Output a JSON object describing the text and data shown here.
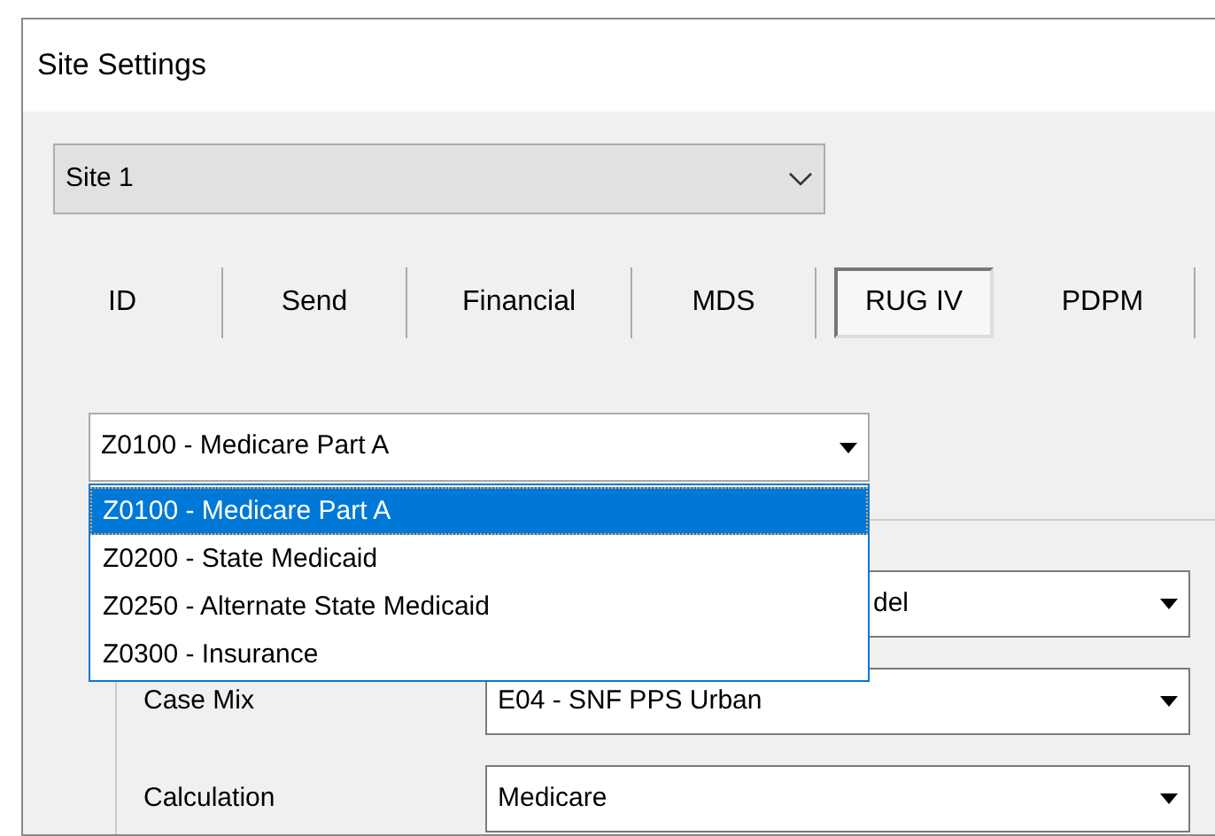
{
  "window": {
    "title": "Site Settings"
  },
  "site": {
    "value": "Site 1"
  },
  "tabs": [
    {
      "label": "ID",
      "selected": false
    },
    {
      "label": "Send",
      "selected": false
    },
    {
      "label": "Financial",
      "selected": false
    },
    {
      "label": "MDS",
      "selected": false
    },
    {
      "label": "RUG IV",
      "selected": true
    },
    {
      "label": "PDPM",
      "selected": false
    }
  ],
  "payer": {
    "value": "Z0100 - Medicare Part A",
    "expanded": true,
    "options": [
      {
        "label": "Z0100 - Medicare Part A",
        "selected": true
      },
      {
        "label": "Z0200 - State Medicaid",
        "selected": false
      },
      {
        "label": "Z0250 - Alternate State Medicaid",
        "selected": false
      },
      {
        "label": "Z0300 - Insurance",
        "selected": false
      }
    ]
  },
  "fields": [
    {
      "value": "del"
    },
    {
      "label": "Case Mix",
      "value": "E04 - SNF PPS Urban"
    },
    {
      "label": "Calculation",
      "value": "Medicare"
    }
  ]
}
